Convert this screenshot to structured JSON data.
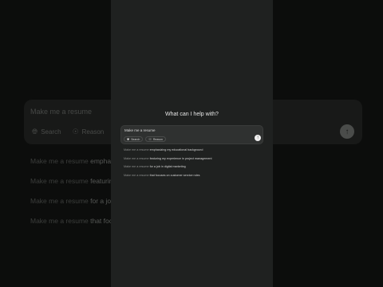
{
  "background": {
    "prompt": "Make me a resume",
    "options": [
      {
        "label": "Search",
        "icon": "globe-icon"
      },
      {
        "label": "Reason",
        "icon": "lightbulb-icon"
      }
    ],
    "send_icon": "arrow-up-icon",
    "suggestions": [
      {
        "prefix": "Make me a resume",
        "suffix": " emphasi"
      },
      {
        "prefix": "Make me a resume",
        "suffix": " featuring"
      },
      {
        "prefix": "Make me a resume",
        "suffix": " for a job"
      },
      {
        "prefix": "Make me a resume",
        "suffix": " that focu"
      }
    ]
  },
  "panel": {
    "title": "What can I help with?",
    "input": {
      "value": "Make me a resume"
    },
    "options": [
      {
        "label": "Search",
        "icon": "globe-icon"
      },
      {
        "label": "Reason",
        "icon": "lightbulb-icon"
      }
    ],
    "send_icon": "arrow-up-icon",
    "suggestions": [
      {
        "prefix": "Make me a resume",
        "suffix": " emphasizing my educational background"
      },
      {
        "prefix": "Make me a resume",
        "suffix": " featuring my experience in project management"
      },
      {
        "prefix": "Make me a resume",
        "suffix": " for a job in digital marketing"
      },
      {
        "prefix": "Make me a resume",
        "suffix": " that focuses on customer service roles"
      }
    ]
  },
  "colors": {
    "panel_bg": "#1f2120",
    "input_bg": "#2f3130",
    "send_bg": "#f0f0f0"
  }
}
